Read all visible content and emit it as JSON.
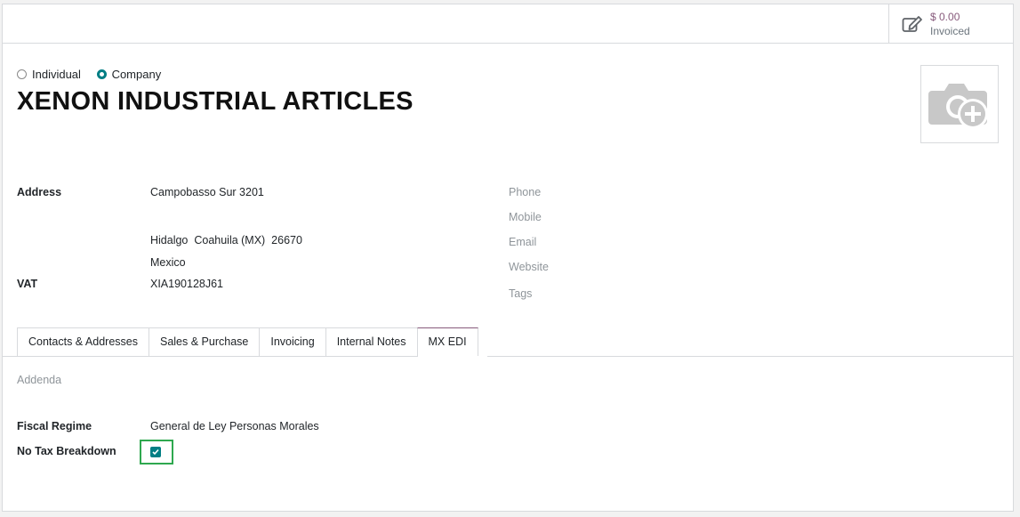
{
  "stat_button": {
    "value": "$ 0.00",
    "label": "Invoiced",
    "icon": "pencil-square-icon"
  },
  "company_type": {
    "options": [
      {
        "label": "Individual",
        "checked": false
      },
      {
        "label": "Company",
        "checked": true
      }
    ]
  },
  "partner_name": "XENON INDUSTRIAL ARTICLES",
  "address": {
    "label": "Address",
    "street": "Campobasso Sur 3201",
    "city_line": "Hidalgo  Coahuila (MX)  26670",
    "country": "Mexico"
  },
  "vat": {
    "label": "VAT",
    "value": "XIA190128J61"
  },
  "contact_fields": [
    "Phone",
    "Mobile",
    "Email",
    "Website",
    "Tags"
  ],
  "tabs": [
    "Contacts & Addresses",
    "Sales & Purchase",
    "Invoicing",
    "Internal Notes",
    "MX EDI"
  ],
  "active_tab": "MX EDI",
  "mx_edi": {
    "addenda_label": "Addenda",
    "fiscal_regime_label": "Fiscal Regime",
    "fiscal_regime_value": "General de Ley Personas Morales",
    "no_tax_breakdown_label": "No Tax Breakdown",
    "no_tax_breakdown_checked": true
  },
  "colors": {
    "accent": "#017e84",
    "brand": "#875a7b",
    "focus": "#2fa84f"
  }
}
